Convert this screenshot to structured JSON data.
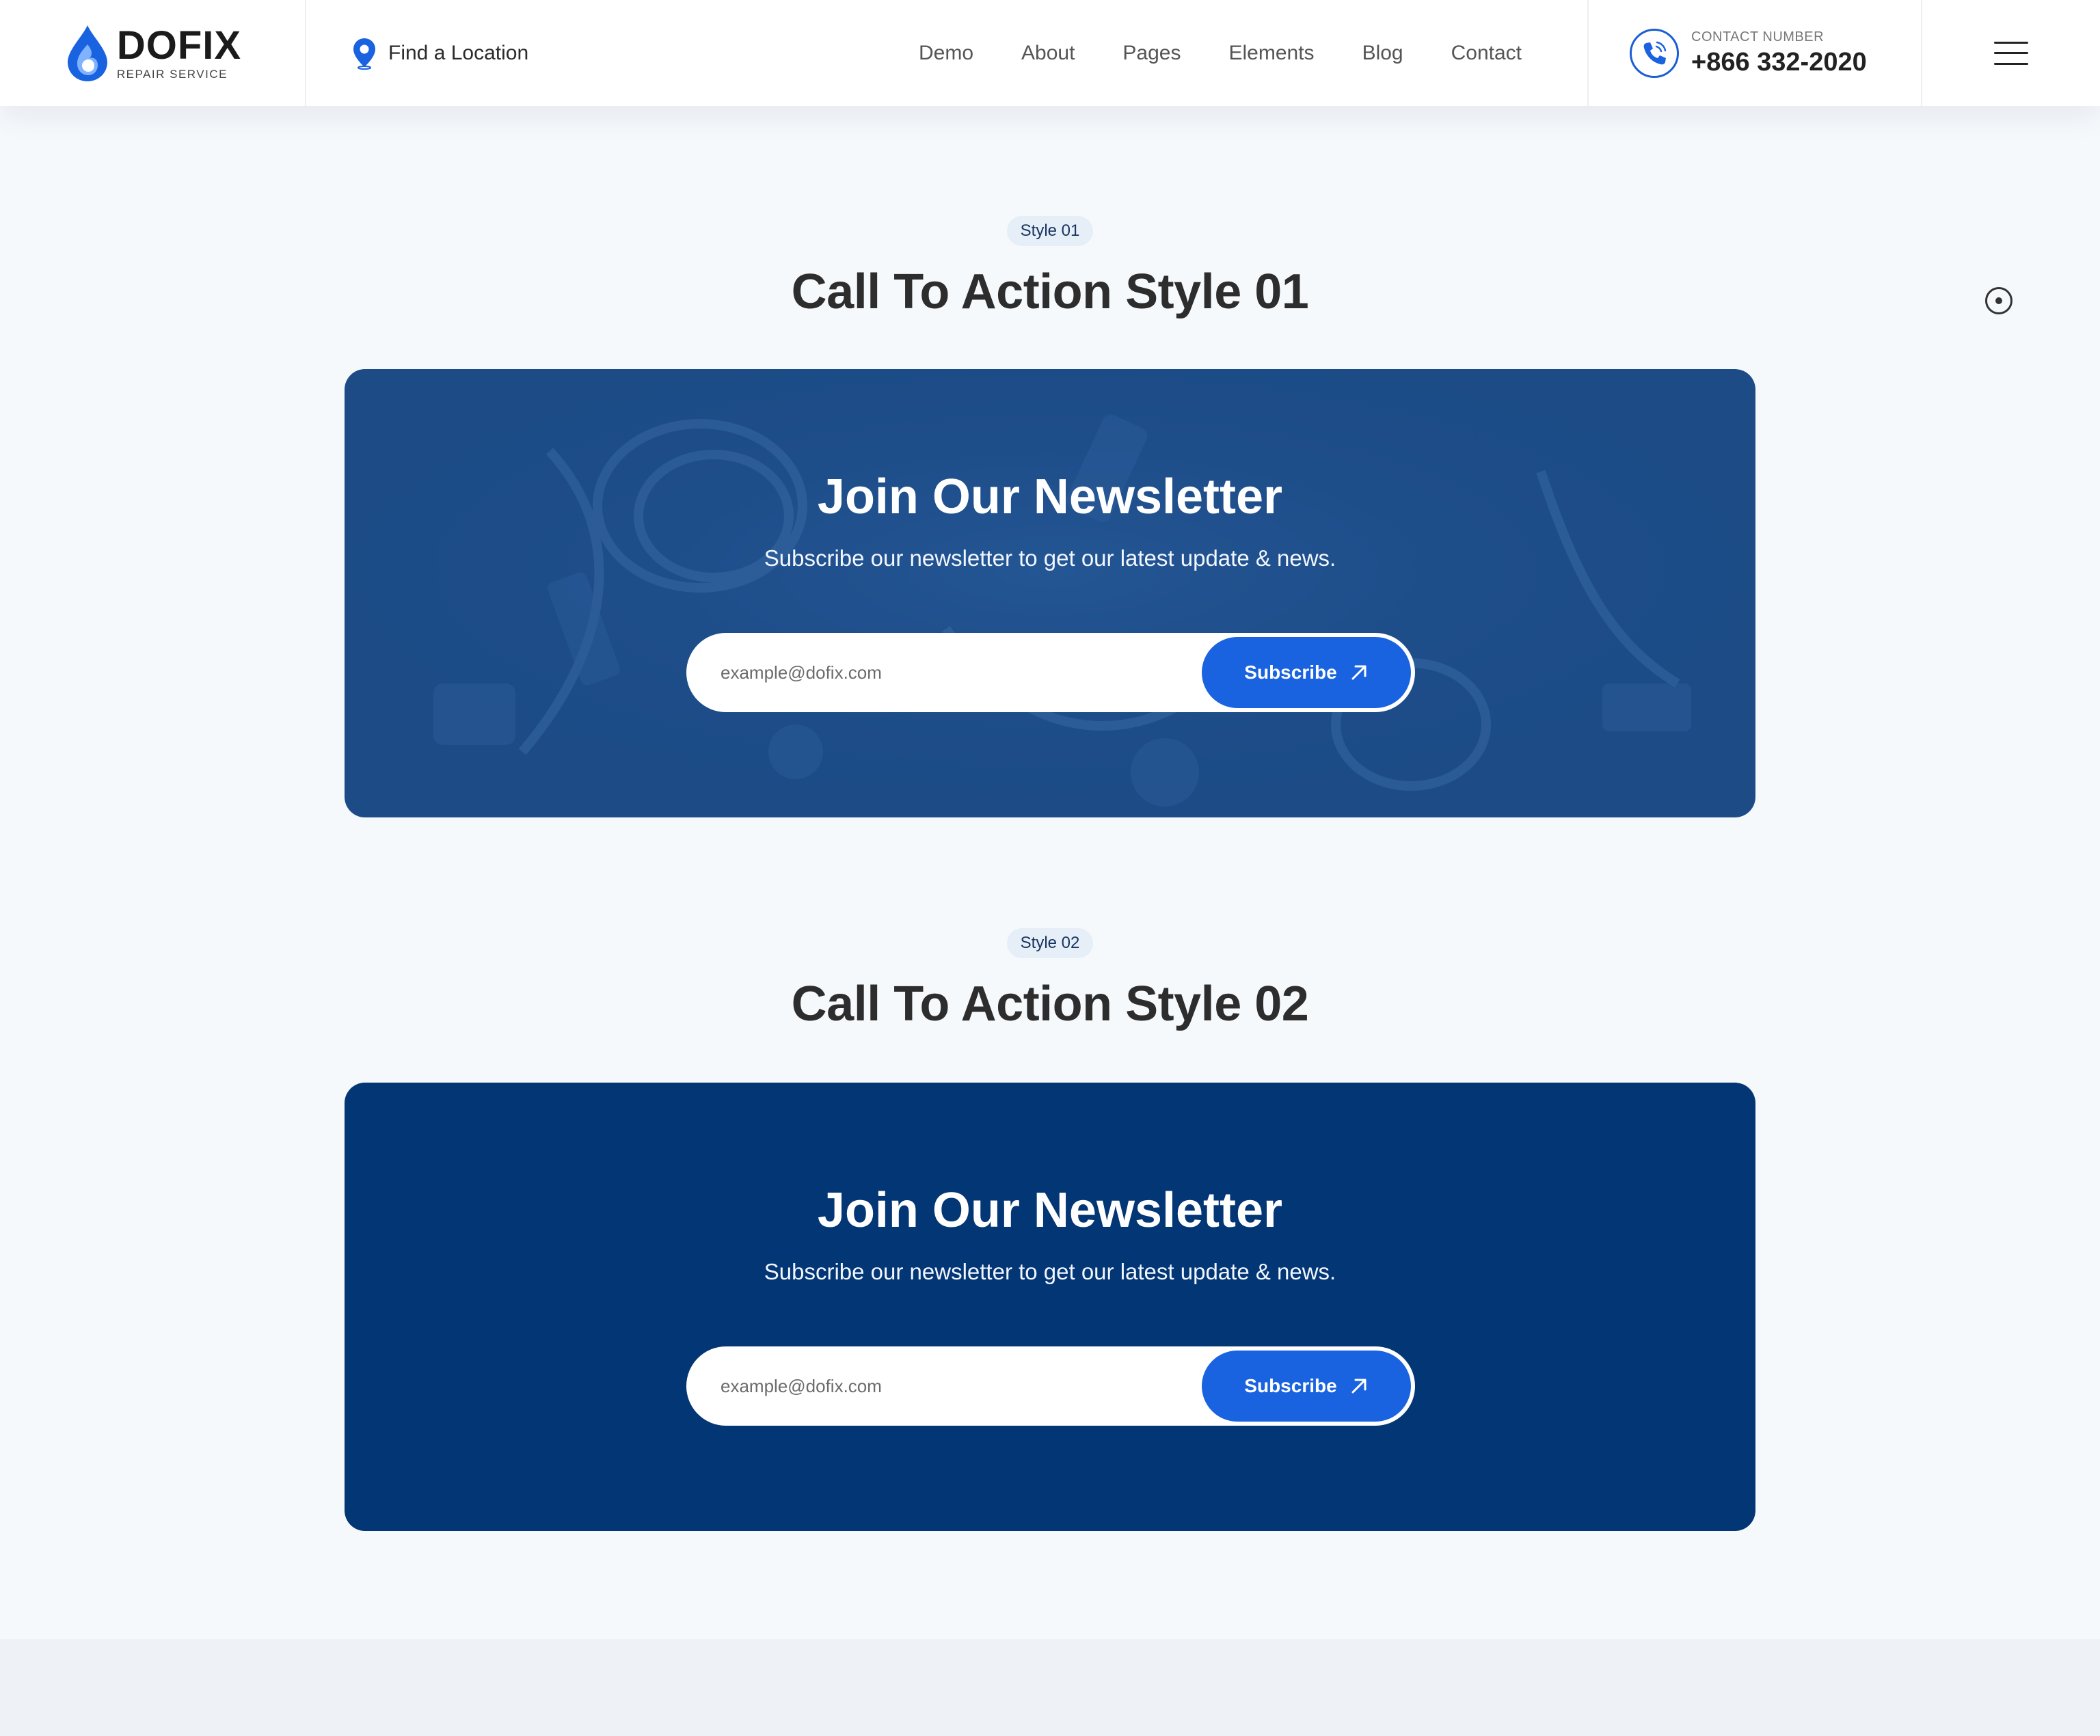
{
  "header": {
    "logo_name": "DOFIX",
    "logo_tag": "REPAIR SERVICE",
    "location_label": "Find a Location",
    "nav": [
      "Demo",
      "About",
      "Pages",
      "Elements",
      "Blog",
      "Contact"
    ],
    "contact_label": "CONTACT NUMBER",
    "contact_number": "+866 332-2020"
  },
  "colors": {
    "accent": "#1a63e0",
    "card_style1": "#1c4b86",
    "card_style2": "#033674",
    "badge_bg": "#e6eef8"
  },
  "sections": [
    {
      "badge": "Style 01",
      "title": "Call To Action Style 01",
      "cta_title": "Join Our Newsletter",
      "cta_sub": "Subscribe our newsletter to get our latest update & news.",
      "email_placeholder": "example@dofix.com",
      "button_label": "Subscribe"
    },
    {
      "badge": "Style 02",
      "title": "Call To Action Style 02",
      "cta_title": "Join Our Newsletter",
      "cta_sub": "Subscribe our newsletter to get our latest update & news.",
      "email_placeholder": "example@dofix.com",
      "button_label": "Subscribe"
    }
  ],
  "icons": {
    "logo": "water-drop-icon",
    "location": "map-pin-icon",
    "phone": "phone-icon",
    "menu": "hamburger-menu-icon",
    "button_arrow": "arrow-up-right-icon",
    "side": "radio-dot-icon"
  }
}
